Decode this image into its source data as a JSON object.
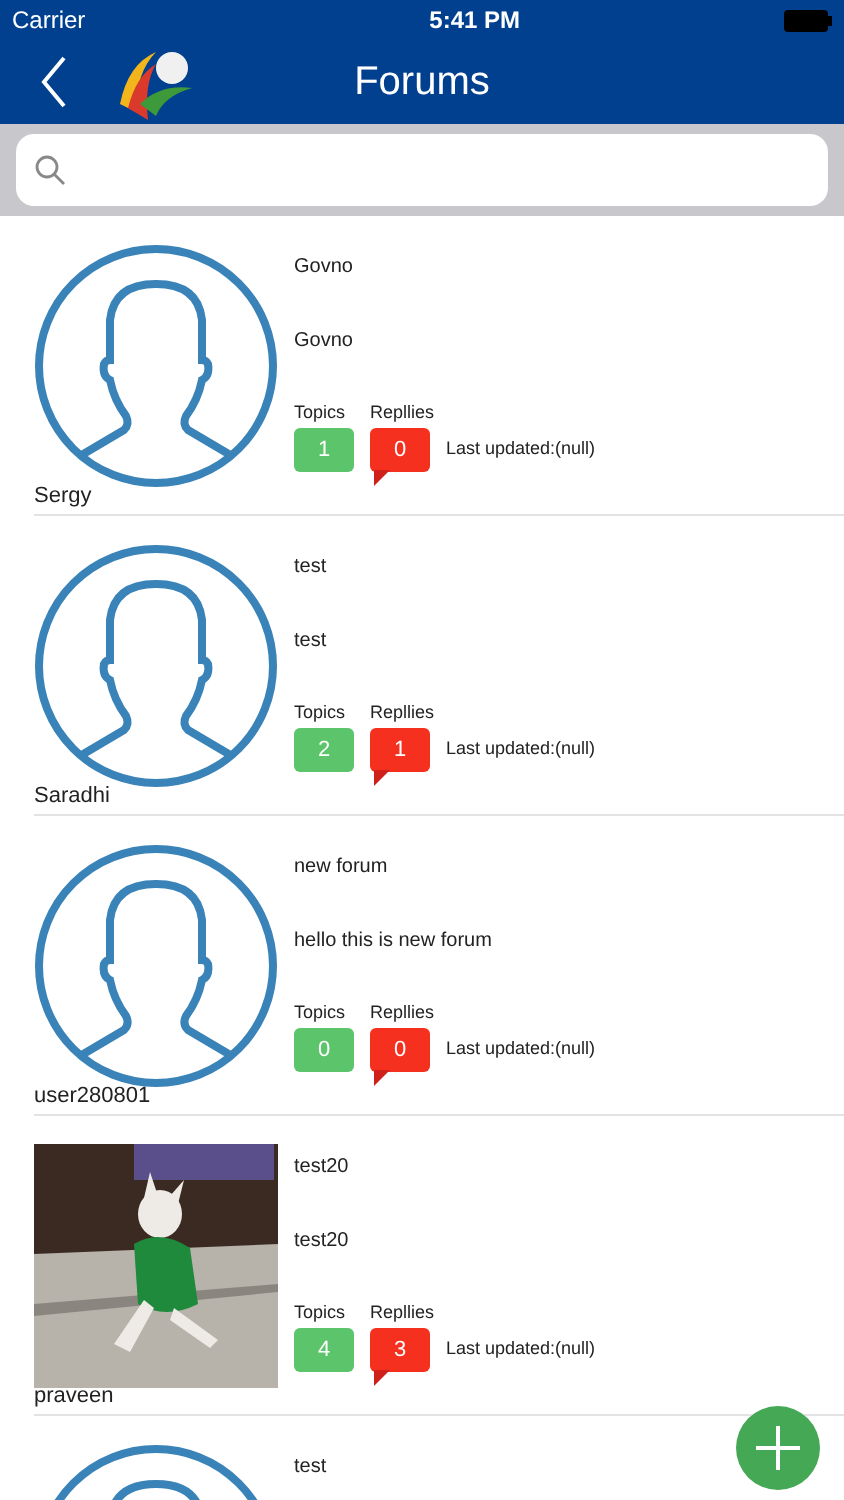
{
  "status_bar": {
    "carrier": "Carrier",
    "time": "5:41 PM"
  },
  "nav": {
    "title": "Forums"
  },
  "forums": [
    {
      "title": "Govno",
      "description": "Govno",
      "topics_label": "Topics",
      "replies_label": "Repllies",
      "topics": "1",
      "replies": "0",
      "updated": "Last updated:(null)",
      "author": "Sergy"
    },
    {
      "title": "test",
      "description": "test",
      "topics_label": "Topics",
      "replies_label": "Repllies",
      "topics": "2",
      "replies": "1",
      "updated": "Last updated:(null)",
      "author": "Saradhi"
    },
    {
      "title": "new forum",
      "description": "hello this is new forum",
      "topics_label": "Topics",
      "replies_label": "Repllies",
      "topics": "0",
      "replies": "0",
      "updated": "Last updated:(null)",
      "author": "user280801"
    },
    {
      "kind": "picture",
      "title": "test20",
      "description": "test20",
      "topics_label": "Topics",
      "replies_label": "Repllies",
      "topics": "4",
      "replies": "3",
      "updated": "Last updated:(null)",
      "author": "praveen"
    },
    {
      "title": "test"
    }
  ]
}
